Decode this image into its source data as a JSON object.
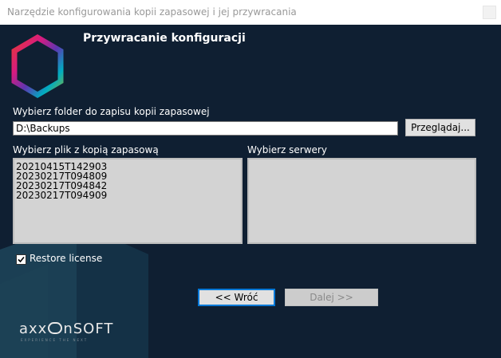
{
  "window": {
    "title": "Narzędzie konfigurowania kopii zapasowej i jej przywracania"
  },
  "header": {
    "title": "Przywracanie konfiguracji",
    "logo_icon": "hexagon-gradient-logo"
  },
  "backup_folder": {
    "label": "Wybierz folder do zapisu kopii zapasowej",
    "value": "D:\\Backups",
    "browse_label": "Przeglądaj..."
  },
  "backup_files": {
    "label": "Wybierz plik z kopią zapasową",
    "items": [
      "20210415T142903",
      "20230217T094809",
      "20230217T094842",
      "20230217T094909"
    ]
  },
  "servers": {
    "label": "Wybierz serwery",
    "items": []
  },
  "restore_license": {
    "label": "Restore license",
    "checked": true
  },
  "navigation": {
    "back_label": "<< Wróć",
    "next_label": "Dalej >>",
    "next_enabled": false
  },
  "brand": {
    "name_left": "axx",
    "name_right": "nSOFT",
    "tagline": "EXPERIENCE THE NEXT"
  },
  "colors": {
    "background": "#0f1f32",
    "accent": "#0078d7",
    "list_background": "#d3d3d3"
  }
}
